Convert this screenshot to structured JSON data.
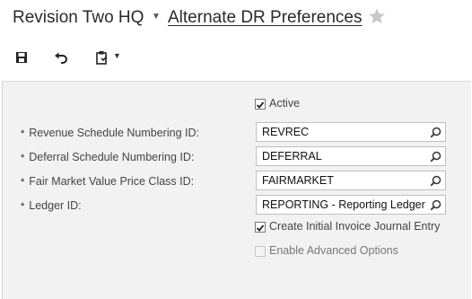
{
  "header": {
    "company": "Revision Two HQ",
    "screen_title": "Alternate DR Preferences"
  },
  "toolbar": {
    "save_icon": "save-icon",
    "undo_icon": "undo-icon",
    "clipboard_icon": "clipboard-icon"
  },
  "form": {
    "active": {
      "label": "Active",
      "checked": true
    },
    "fields": [
      {
        "label": "Revenue Schedule Numbering ID:",
        "value": "REVREC",
        "required": true
      },
      {
        "label": "Deferral Schedule Numbering ID:",
        "value": "DEFERRAL",
        "required": true
      },
      {
        "label": "Fair Market Value Price Class ID:",
        "value": "FAIRMARKET",
        "required": true
      },
      {
        "label": "Ledger ID:",
        "value": "REPORTING - Reporting Ledger",
        "required": true
      }
    ],
    "create_initial_invoice": {
      "label": "Create Initial Invoice Journal Entry",
      "checked": true
    },
    "enable_advanced": {
      "label": "Enable Advanced Options",
      "checked": false,
      "disabled": true
    }
  },
  "required_marker": "*"
}
